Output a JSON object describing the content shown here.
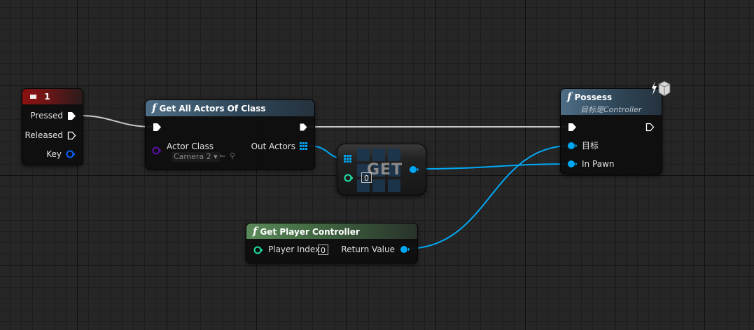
{
  "key_node": {
    "title": "1",
    "pins": {
      "pressed": "Pressed",
      "released": "Released",
      "key": "Key"
    }
  },
  "get_all_actors": {
    "title": "Get All Actors Of Class",
    "actor_class_label": "Actor Class",
    "actor_class_value": "Camera 2",
    "out_actors_label": "Out Actors"
  },
  "get_node": {
    "title": "GET",
    "index_value": "0"
  },
  "possess": {
    "title": "Possess",
    "subtitle": "目标是Controller",
    "target_label": "目标",
    "in_pawn_label": "In Pawn"
  },
  "get_player_controller": {
    "title": "Get Player Controller",
    "player_index_label": "Player Index",
    "player_index_value": "0",
    "return_value_label": "Return Value"
  },
  "colors": {
    "exec_wire": "#c8c8c8",
    "object_pin": "#00a8f4",
    "class_pin": "#5c10a8",
    "struct_pin": "#0a60ff",
    "integer_pin": "#1fe0a8",
    "function_header": "#4e6e86",
    "event_header": "#8c1111",
    "pure_header": "#5a8a5a"
  }
}
